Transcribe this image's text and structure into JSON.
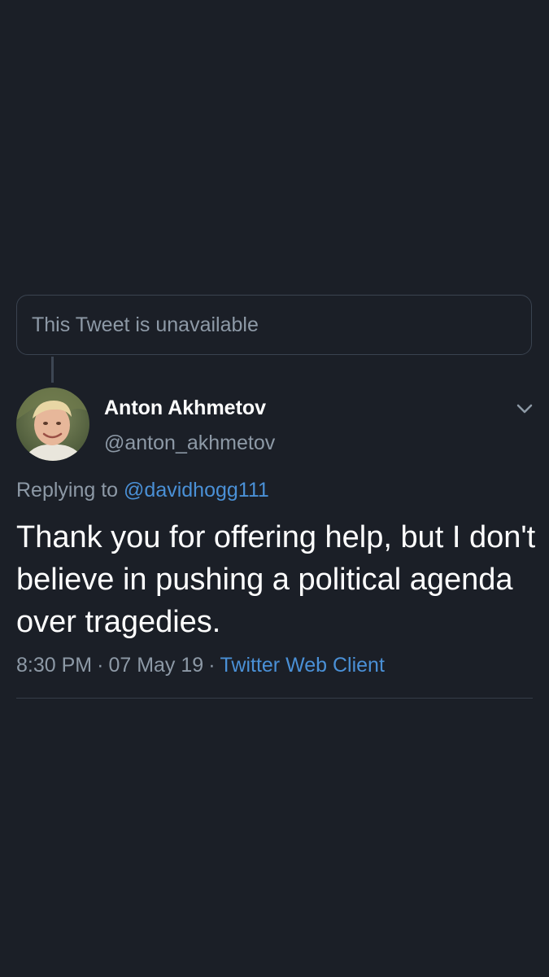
{
  "quoted": {
    "unavailable_text": "This Tweet is unavailable"
  },
  "author": {
    "display_name": "Anton Akhmetov",
    "handle": "@anton_akhmetov",
    "avatar_icon": "user-avatar-photo"
  },
  "reply": {
    "prefix": "Replying to",
    "mention": "@davidhogg111"
  },
  "tweet": {
    "text": "Thank you for offering help, but I don't believe in pushing a political agenda over tragedies.",
    "time": "8:30 PM",
    "date": "07 May 19",
    "separator": "·",
    "client": "Twitter Web Client"
  },
  "icons": {
    "menu": "chevron-down-icon"
  },
  "colors": {
    "background": "#1b1f27",
    "secondary_text": "#8d99a6",
    "link": "#4a90d6",
    "border": "#3a4350"
  }
}
